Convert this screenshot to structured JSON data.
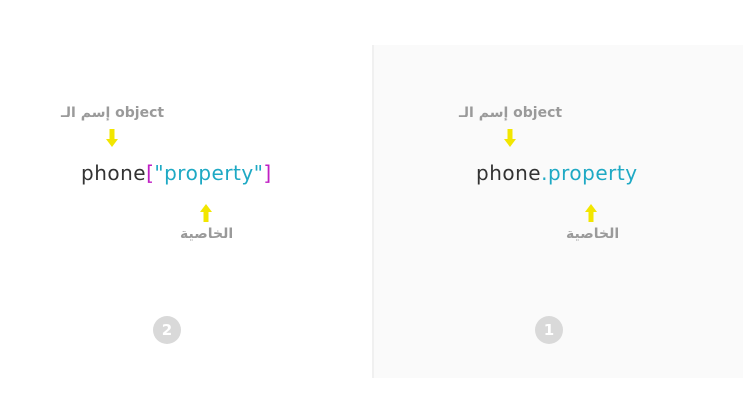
{
  "left": {
    "object_label": "إسم الـ object",
    "code_object": "phone",
    "code_open_bracket": "[",
    "code_property": "\"property\"",
    "code_close_bracket": "]",
    "property_label": "الخاصية",
    "badge": "2"
  },
  "right": {
    "object_label": "إسم الـ object",
    "code_object": "phone",
    "code_dot": ".",
    "code_property": "property",
    "property_label": "الخاصية",
    "badge": "1"
  },
  "colors": {
    "arrow": "#f2e600",
    "property": "#1ea9c4",
    "bracket": "#c01fc4",
    "object": "#333333",
    "label": "#9a9a9a",
    "badge": "#d9d9d9"
  }
}
